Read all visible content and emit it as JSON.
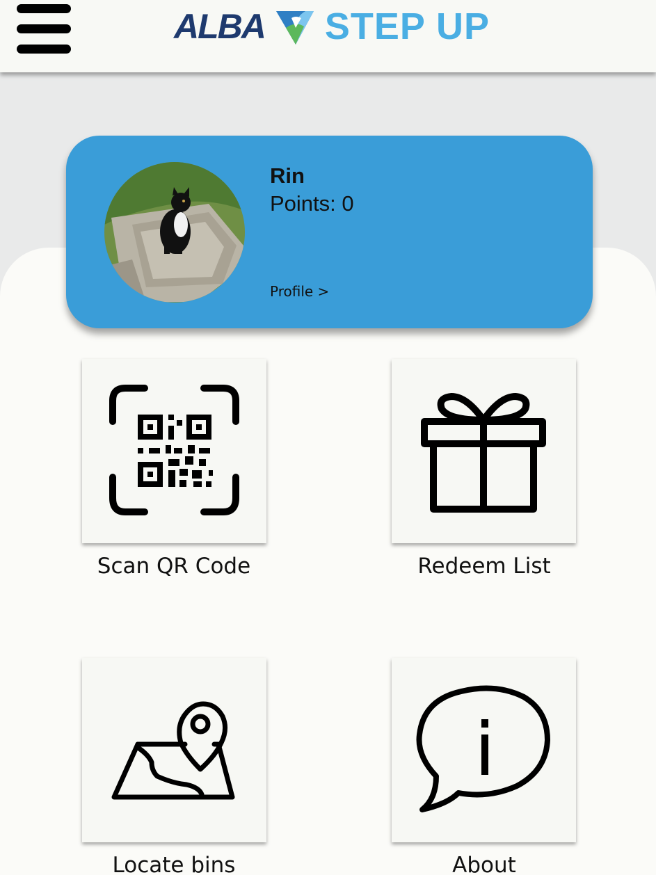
{
  "header": {
    "logo_left": "ALBA",
    "logo_right": "STEP UP",
    "logo_colors": {
      "alba": "#1e3a6e",
      "step_up": "#4aaee3",
      "mark_blue": "#2f7fc4",
      "mark_green": "#5cb85c"
    }
  },
  "profile": {
    "name": "Rin",
    "points": "Points: 0",
    "link": "Profile >",
    "card_color": "#3a9dd8"
  },
  "tiles": [
    {
      "label": "Scan QR Code",
      "icon": "qr-code-scan-icon"
    },
    {
      "label": "Redeem List",
      "icon": "gift-icon"
    },
    {
      "label": "Locate bins",
      "icon": "map-pin-icon"
    },
    {
      "label": "About",
      "icon": "info-speech-bubble-icon"
    }
  ]
}
